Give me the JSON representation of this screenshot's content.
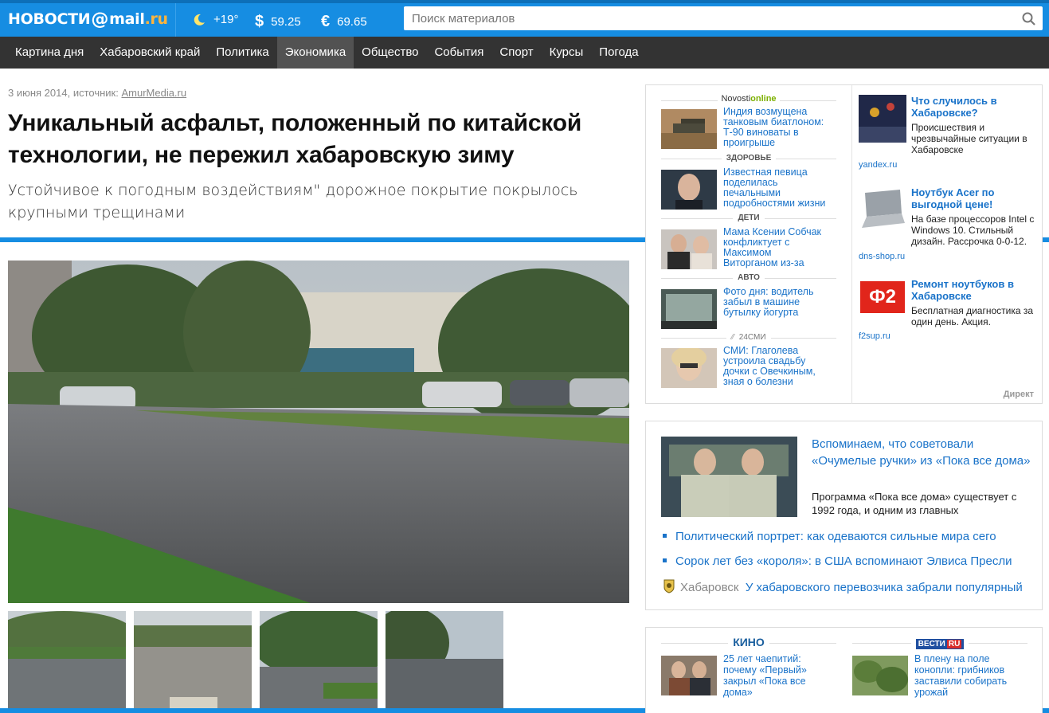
{
  "header": {
    "logo_part1": "НОВОСТИ",
    "logo_at": "@",
    "logo_part2": "mail",
    "logo_dot_ru": ".ru",
    "weather": "+19°",
    "usd_symbol": "$",
    "usd": "59.25",
    "eur_symbol": "€",
    "eur": "69.65",
    "search_placeholder": "Поиск материалов"
  },
  "nav": {
    "items": [
      "Картина дня",
      "Хабаровский край",
      "Политика",
      "Экономика",
      "Общество",
      "События",
      "Спорт",
      "Курсы",
      "Погода"
    ],
    "active": "Экономика"
  },
  "article": {
    "date_source": "3 июня 2014, источник: ",
    "source": "AmurMedia.ru",
    "title": "Уникальный асфальт, положенный по китайской технологии, не пережил хабаровскую зиму",
    "subtitle": "Устойчивое к погодным воздействиям\" дорожное покрытие покрылось крупными трещинами"
  },
  "novosti_online": {
    "brand1": "Novosti",
    "brand2": "online",
    "items": [
      {
        "section": "",
        "text": "Индия возмущена танковым биатлоном: Т-90 виноваты в проигрыше"
      },
      {
        "section": "ЗДОРОВЬЕ",
        "text": "Известная певица поделилась печальными подробностями жизни"
      },
      {
        "section": "ДЕТИ",
        "text": "Мама Ксении Собчак конфликтует с Максимом Виторганом из-за внука"
      },
      {
        "section": "АВТО",
        "text": "Фото дня: водитель забыл в машине бутылку йогурта"
      },
      {
        "section": "24СМИ",
        "text": "СМИ: Глаголева устроила свадьбу дочки с Овечкиным, зная о болезни"
      }
    ]
  },
  "direct": {
    "label": "Директ",
    "ads": [
      {
        "title": "Что случилось в Хабаровске?",
        "desc": "Происшествия и чрезвычайные ситуации в Хабаровске",
        "domain": "yandex.ru"
      },
      {
        "title": "Ноутбук Acer по выгодной цене!",
        "desc": "На базе процессоров Intel с Windows 10. Стильный дизайн. Рассрочка 0-0-12.",
        "domain": "dns-shop.ru"
      },
      {
        "title": "Ремонт ноутбуков в Хабаровске",
        "desc": "Бесплатная диагностика за один день. Акция.",
        "domain": "f2sup.ru",
        "logo": "Ф2"
      }
    ]
  },
  "featured": {
    "headline": "Вспоминаем, что советовали «Очумелые ручки» из «Пока все дома»",
    "body": "Программа «Пока все дома» существует с 1992 года, и одним из главных",
    "links": [
      "Политический портрет: как одеваются сильные мира сего",
      "Сорок лет без «короля»: в США вспоминают Элвиса Пресли"
    ],
    "city": "Хабаровск",
    "city_link": "У хабаровского перевозчика забрали популярный"
  },
  "bottom": {
    "kino_label": "КИНО",
    "vesti_label": "ВЕСТИ",
    "vesti_ru": "RU",
    "kino_item": "25 лет чаепитий: почему «Первый» закрыл «Пока все дома»",
    "vesti_item": "В плену на поле конопли: грибников заставили собирать урожай"
  },
  "colors": {
    "brand_blue": "#168de2",
    "nav_bg": "#333333",
    "link": "#1a73c9",
    "accent_orange": "#ffb43b",
    "online_green": "#7cb000"
  }
}
